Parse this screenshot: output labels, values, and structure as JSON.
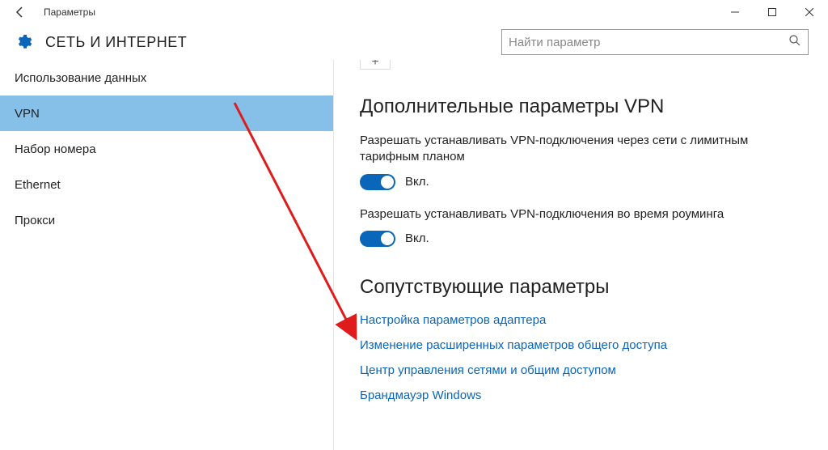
{
  "window": {
    "title": "Параметры"
  },
  "header": {
    "title": "СЕТЬ И ИНТЕРНЕТ"
  },
  "search": {
    "placeholder": "Найти параметр"
  },
  "sidebar": {
    "items": [
      {
        "label": "Использование данных"
      },
      {
        "label": "VPN"
      },
      {
        "label": "Набор номера"
      },
      {
        "label": "Ethernet"
      },
      {
        "label": "Прокси"
      }
    ]
  },
  "main": {
    "section1_title": "Дополнительные параметры VPN",
    "setting1": {
      "label": "Разрешать устанавливать VPN-подключения через сети с лимитным тарифным планом",
      "state": "Вкл."
    },
    "setting2": {
      "label": "Разрешать устанавливать VPN-подключения во время роуминга",
      "state": "Вкл."
    },
    "section2_title": "Сопутствующие параметры",
    "links": [
      "Настройка параметров адаптера",
      "Изменение расширенных параметров общего доступа",
      "Центр управления сетями и общим доступом",
      "Брандмауэр Windows"
    ]
  }
}
